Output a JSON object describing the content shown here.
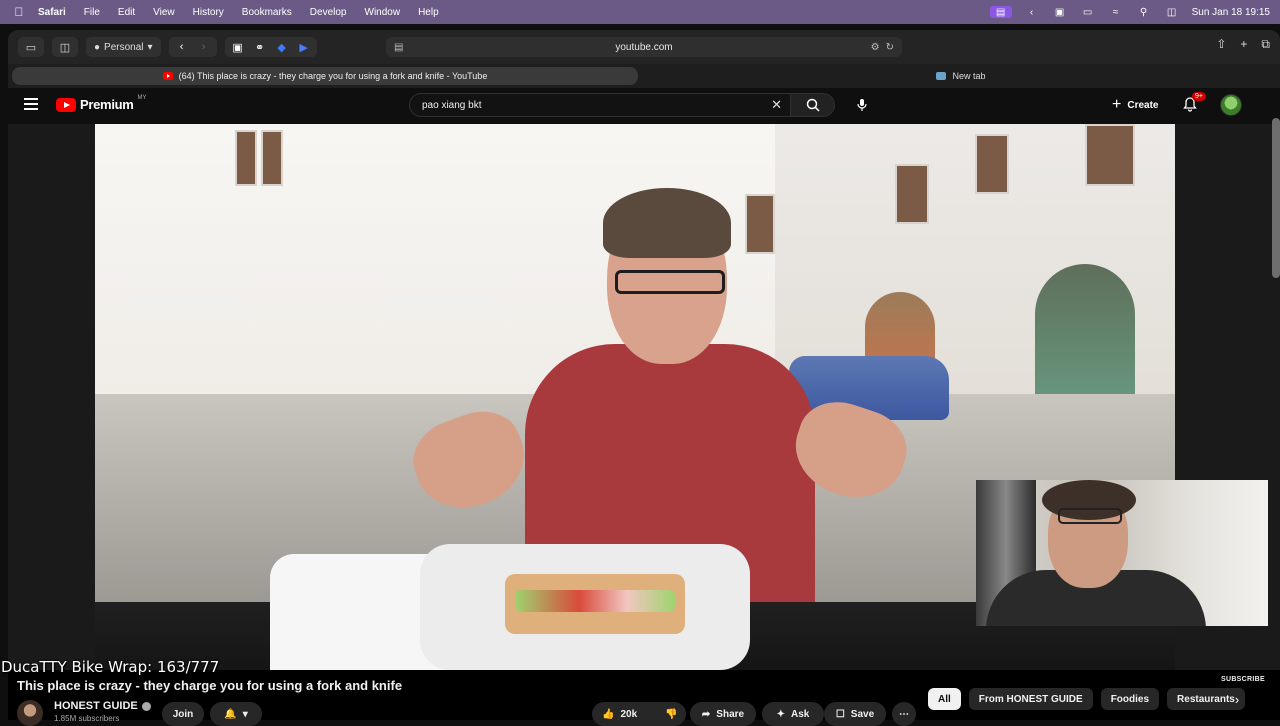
{
  "menubar": {
    "app": "Safari",
    "items": [
      "File",
      "Edit",
      "View",
      "History",
      "Bookmarks",
      "Develop",
      "Window",
      "Help"
    ],
    "clock": "Sun Jan 18  19:15"
  },
  "toolbar": {
    "profile": "Personal",
    "url": "youtube.com"
  },
  "tabs": {
    "active": "(64) This place is crazy - they charge you for using a fork and knife - YouTube",
    "inactive": "New tab"
  },
  "youtube": {
    "brand": "Premium",
    "region": "MY",
    "search_value": "pao xiang bkt",
    "create_label": "Create",
    "notif_count": "9+"
  },
  "video": {
    "overlay_text": "DucaTTY Bike Wrap: 163/777",
    "subscribe_mark": "SUBSCRIBE",
    "title": "This place is crazy - they charge you for using a fork and knife"
  },
  "channel": {
    "name": "HONEST GUIDE",
    "subs": "1.85M subscribers",
    "join": "Join"
  },
  "actions": {
    "likes": "20k",
    "share": "Share",
    "ask": "Ask",
    "save": "Save"
  },
  "chips": [
    "All",
    "From HONEST GUIDE",
    "Foodies",
    "Restaurants"
  ],
  "colors": {
    "menubar": "#6c5a86",
    "yt_red": "#ff0000",
    "background": "#0f0f0f"
  }
}
